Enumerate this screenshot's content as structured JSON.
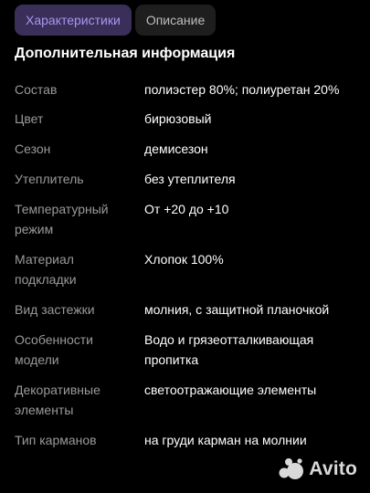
{
  "tabs": [
    {
      "label": "Характеристики",
      "active": true
    },
    {
      "label": "Описание",
      "active": false
    }
  ],
  "section_title": "Дополнительная информация",
  "specs": [
    {
      "label": "Состав",
      "value": "полиэстер 80%; полиуретан 20%"
    },
    {
      "label": "Цвет",
      "value": "бирюзовый"
    },
    {
      "label": "Сезон",
      "value": "демисезон"
    },
    {
      "label": "Утеплитель",
      "value": "без утеплителя"
    },
    {
      "label": "Температурный режим",
      "value": "От +20 до +10"
    },
    {
      "label": "Материал подкладки",
      "value": "Хлопок 100%"
    },
    {
      "label": "Вид застежки",
      "value": "молния, с защитной планочкой"
    },
    {
      "label": "Особенности модели",
      "value": "Водо и грязеотталкивающая пропитка"
    },
    {
      "label": "Декоративные элементы",
      "value": "светоотражающие элементы"
    },
    {
      "label": "Тип карманов",
      "value": "на груди карман на молнии"
    }
  ],
  "watermark": {
    "text": "Avito",
    "icon": "avito-logo-icon"
  },
  "colors": {
    "background": "#000000",
    "tab_active_bg": "#3a2f59",
    "tab_active_text": "#a996ee",
    "tab_inactive_bg": "#1e1e1e",
    "label": "#9a9a9a",
    "value": "#ffffff"
  }
}
